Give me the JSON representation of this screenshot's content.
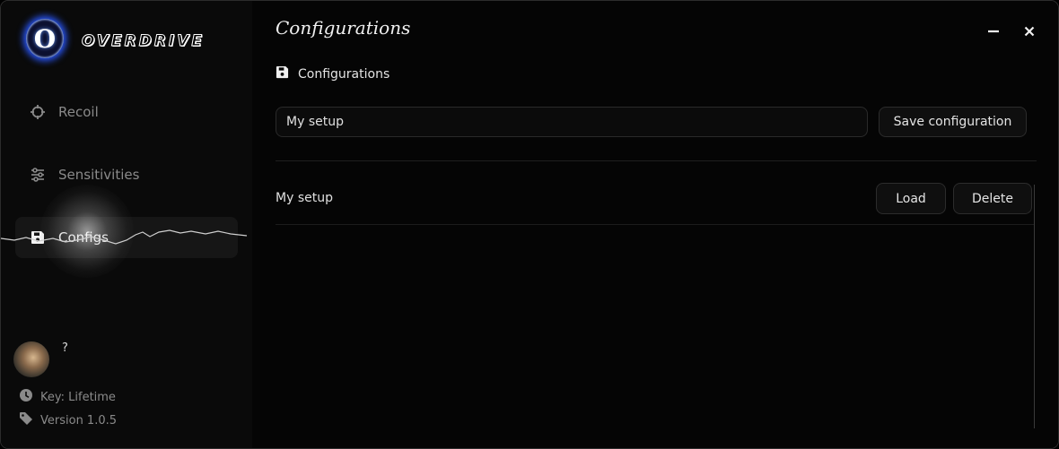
{
  "app": {
    "name": "OVERDRIVE",
    "logo_letter": "O",
    "accent_color": "#2a58ff"
  },
  "sidebar": {
    "items": [
      {
        "label": "Recoil",
        "icon": "crosshair-icon",
        "active": false
      },
      {
        "label": "Sensitivities",
        "icon": "sliders-icon",
        "active": false
      },
      {
        "label": "Configs",
        "icon": "floppy-disk-icon",
        "active": true
      }
    ],
    "user": {
      "name": "?",
      "key_label": "Key: Lifetime",
      "version_label": "Version 1.0.5"
    }
  },
  "main": {
    "title": "Configurations",
    "section_label": "Configurations",
    "config_name_input": {
      "value": "My setup",
      "placeholder": ""
    },
    "save_button_label": "Save configuration",
    "configs": [
      {
        "name": "My setup",
        "load_label": "Load",
        "delete_label": "Delete"
      }
    ]
  }
}
